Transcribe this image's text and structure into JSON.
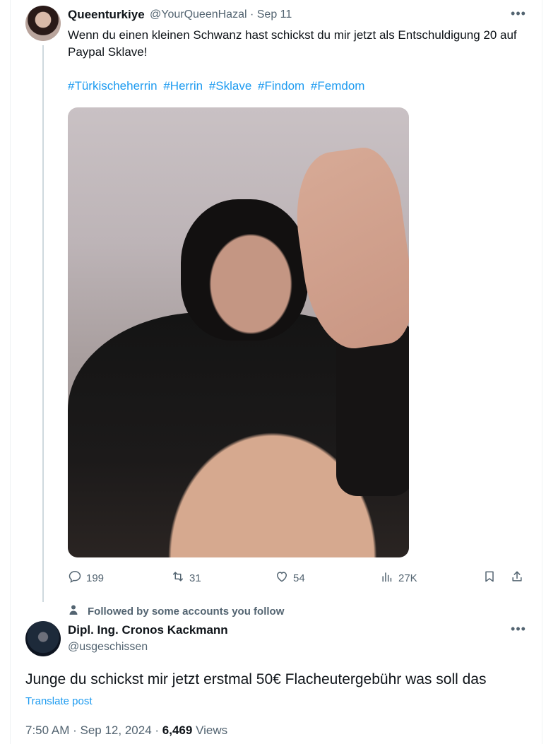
{
  "tweet": {
    "author_name": "Queenturkiye",
    "author_handle": "@YourQueenHazal",
    "date": "Sep 11",
    "text": "Wenn du einen kleinen Schwanz hast schickst du mir jetzt als Entschuldigung 20 auf Paypal Sklave!",
    "hashtags": [
      "#Türkischeherrin",
      "#Herrin",
      "#Sklave",
      "#Findom",
      "#Femdom"
    ],
    "more_icon": "more-horizontal-icon",
    "actions": {
      "replies": "199",
      "reposts": "31",
      "likes": "54",
      "views": "27K"
    }
  },
  "context": {
    "followed_text": "Followed by some accounts you follow",
    "icon": "person-icon"
  },
  "reply": {
    "author_name": "Dipl. Ing. Cronos Kackmann",
    "author_handle": "@usgeschissen",
    "text": "Junge du schickst mir jetzt erstmal 50€ Flacheutergebühr was soll das",
    "translate_label": "Translate post",
    "time": "7:50 AM",
    "date": "Sep 12, 2024",
    "views_count": "6,469",
    "views_label": "Views"
  },
  "colors": {
    "accent": "#1d9bf0",
    "muted": "#536471",
    "text": "#0f1419"
  }
}
